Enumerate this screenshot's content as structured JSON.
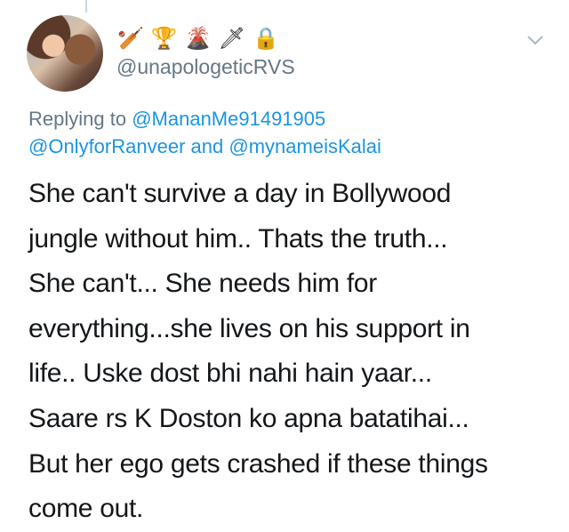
{
  "tweet": {
    "handle": "@unapologeticRVS",
    "badges": [
      {
        "name": "cricket-bat-icon",
        "glyph": "🏏"
      },
      {
        "name": "trophy-icon",
        "glyph": "🏆"
      },
      {
        "name": "volcano-icon",
        "glyph": "🌋"
      },
      {
        "name": "dagger-icon",
        "glyph": "🗡"
      },
      {
        "name": "lock-icon",
        "glyph": "🔒"
      }
    ],
    "reply": {
      "prefix": "Replying to",
      "mention_1": "@MananMe91491905",
      "mention_2": "@OnlyforRanveer",
      "conjunction": "and",
      "mention_3": "@mynameisKalai"
    },
    "lines": [
      "She can't survive a day in Bollywood",
      "jungle without him.. Thats the truth...",
      "She can't... She needs him for",
      "everything...she lives on his support in",
      "life.. Uske dost bhi nahi hain yaar...",
      "Saare rs K Doston ko apna batatihai...",
      "But her ego gets crashed if these things",
      "come out."
    ]
  },
  "colors": {
    "text": "#14171a",
    "secondary": "#657786",
    "link": "#1b95e0",
    "thread_line": "#ccd6dd"
  }
}
